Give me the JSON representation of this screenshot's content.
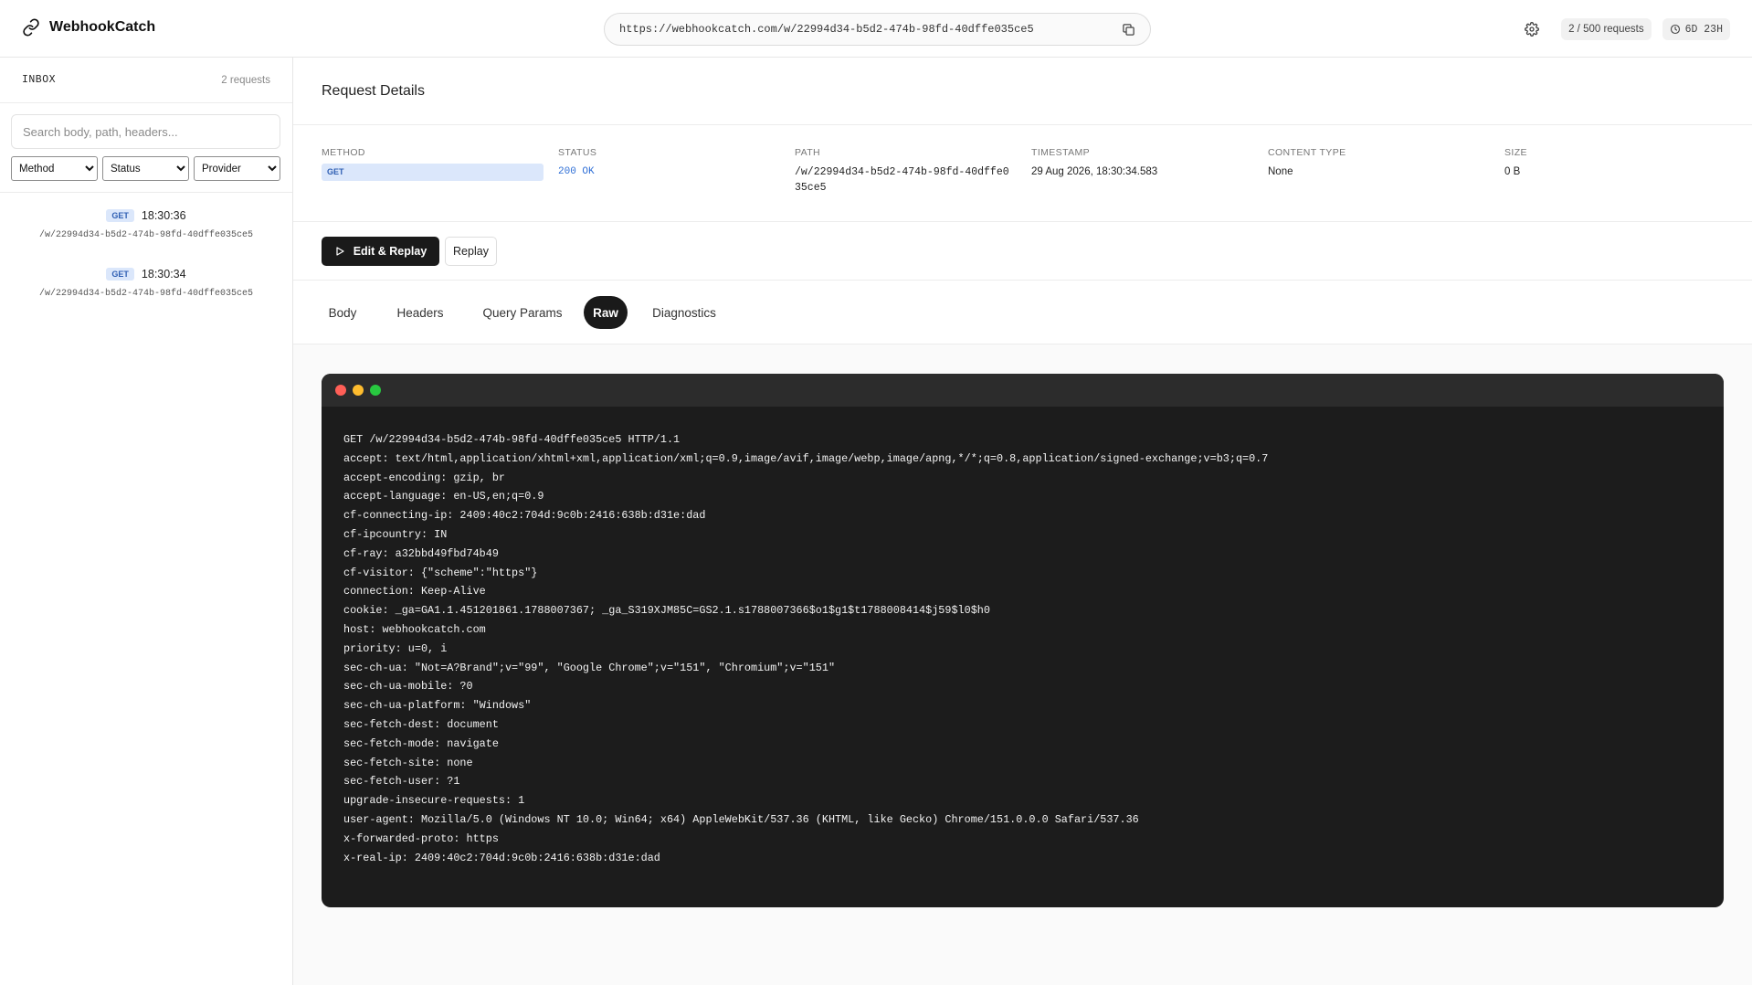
{
  "app": {
    "name": "WebhookCatch",
    "url": "https://webhookcatch.com/w/22994d34-b5d2-474b-98fd-40dffe035ce5",
    "requests_quota": "2 / 500 requests",
    "ttl": "6D 23H"
  },
  "sidebar": {
    "title": "INBOX",
    "count": "2 requests",
    "search_placeholder": "Search body, path, headers...",
    "filters": {
      "method": "Method",
      "status": "Status",
      "provider": "Provider"
    },
    "requests": [
      {
        "method": "GET",
        "time": "18:30:36",
        "path": "/w/22994d34-b5d2-474b-98fd-40dffe035ce5"
      },
      {
        "method": "GET",
        "time": "18:30:34",
        "path": "/w/22994d34-b5d2-474b-98fd-40dffe035ce5"
      }
    ]
  },
  "details": {
    "title": "Request Details",
    "labels": {
      "method": "METHOD",
      "status": "STATUS",
      "path": "PATH",
      "timestamp": "TIMESTAMP",
      "content_type": "CONTENT TYPE",
      "size": "SIZE"
    },
    "values": {
      "method": "GET",
      "status": "200 OK",
      "path": "/w/22994d34-b5d2-474b-98fd-40dffe035ce5",
      "timestamp": "29 Aug 2026, 18:30:34.583",
      "content_type": "None",
      "size": "0 B"
    }
  },
  "actions": {
    "edit_replay": "Edit & Replay",
    "replay": "Replay"
  },
  "tabs": [
    "Body",
    "Headers",
    "Query Params",
    "Raw",
    "Diagnostics"
  ],
  "active_tab": "Raw",
  "raw_lines": [
    "GET /w/22994d34-b5d2-474b-98fd-40dffe035ce5 HTTP/1.1",
    "accept: text/html,application/xhtml+xml,application/xml;q=0.9,image/avif,image/webp,image/apng,*/*;q=0.8,application/signed-exchange;v=b3;q=0.7",
    "accept-encoding: gzip, br",
    "accept-language: en-US,en;q=0.9",
    "cf-connecting-ip: 2409:40c2:704d:9c0b:2416:638b:d31e:dad",
    "cf-ipcountry: IN",
    "cf-ray: a32bbd49fbd74b49",
    "cf-visitor: {\"scheme\":\"https\"}",
    "connection: Keep-Alive",
    "cookie: _ga=GA1.1.451201861.1788007367; _ga_S319XJM85C=GS2.1.s1788007366$o1$g1$t1788008414$j59$l0$h0",
    "host: webhookcatch.com",
    "priority: u=0, i",
    "sec-ch-ua: \"Not=A?Brand\";v=\"99\", \"Google Chrome\";v=\"151\", \"Chromium\";v=\"151\"",
    "sec-ch-ua-mobile: ?0",
    "sec-ch-ua-platform: \"Windows\"",
    "sec-fetch-dest: document",
    "sec-fetch-mode: navigate",
    "sec-fetch-site: none",
    "sec-fetch-user: ?1",
    "upgrade-insecure-requests: 1",
    "user-agent: Mozilla/5.0 (Windows NT 10.0; Win64; x64) AppleWebKit/537.36 (KHTML, like Gecko) Chrome/151.0.0.0 Safari/537.36",
    "x-forwarded-proto: https",
    "x-real-ip: 2409:40c2:704d:9c0b:2416:638b:d31e:dad"
  ],
  "colors": {
    "accent_blue": "#2f6fd6",
    "method_badge_bg": "#dbe7fb",
    "terminal_bg": "#1c1c1c",
    "dot_red": "#ff5f57",
    "dot_yellow": "#febc2e",
    "dot_green": "#28c840"
  },
  "icons": {
    "brand": "link-icon",
    "copy": "copy-icon",
    "settings": "gear-icon",
    "ttl": "clock-icon",
    "play": "play-icon"
  }
}
